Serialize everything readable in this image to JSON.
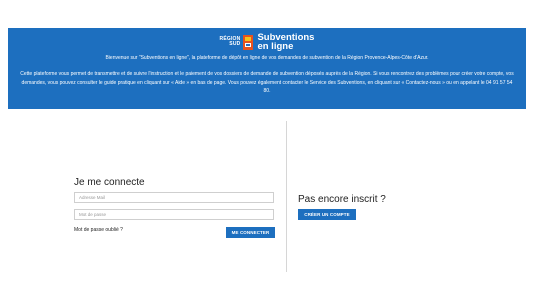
{
  "header": {
    "region_logo_line1": "RÉGION",
    "region_logo_line2": "SUD",
    "app_name_line1": "Subventions",
    "app_name_line2": "en ligne",
    "welcome": "Bienvenue sur \"Subventions en ligne\", la plateforme de dépôt en ligne de vos demandes de subvention de la Région Provence-Alpes-Côte d'Azur.",
    "description": "Cette plateforme vous permet de transmettre et de suivre l'instruction et le paiement de vos dossiers de demande de subvention déposés auprès de la Région. Si vous rencontrez des problèmes pour créer votre compte, vos demandes, vous pouvez consulter le guide pratique en cliquant sur « Aide » en bas de page. Vous pouvez également contacter le Service des Subventions, en cliquant sur « Contactez-nous » ou en appelant le 04 91 57 54 80."
  },
  "login": {
    "title": "Je me connecte",
    "email_placeholder": "Adresse Mail",
    "password_placeholder": "Mot de passe",
    "forgot_password": "Mot de passe oublié ?",
    "submit_label": "ME CONNECTER"
  },
  "signup": {
    "title": "Pas encore inscrit ?",
    "button_label": "CRÉER UN COMPTE"
  },
  "colors": {
    "brand_blue": "#1d6fbf",
    "logo_orange": "#e8521d"
  }
}
